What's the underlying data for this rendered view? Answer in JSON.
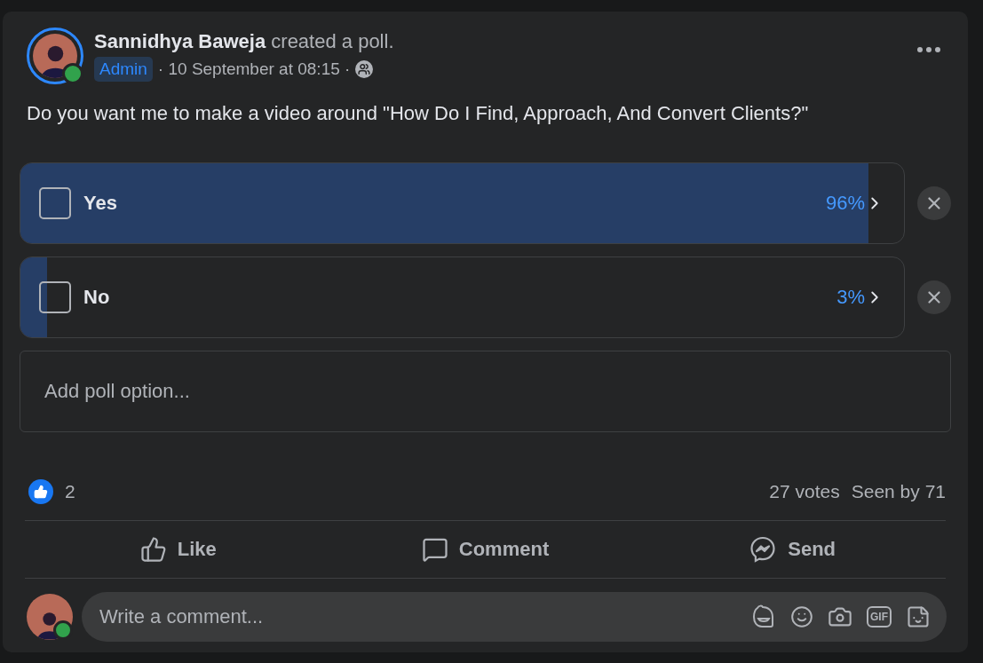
{
  "post": {
    "author": "Sannidhya Baweja",
    "action": "created a poll.",
    "badge": "Admin",
    "timestamp": "· 10 September at 08:15 ·",
    "online": true,
    "question": "Do you want me to make a video around \"How Do I Find, Approach, And Convert Clients?\""
  },
  "poll": {
    "options": [
      {
        "label": "Yes",
        "percent": "96%",
        "level": 0.96,
        "checked": false
      },
      {
        "label": "No",
        "percent": "3%",
        "level": 0.03,
        "checked": false
      }
    ],
    "add_placeholder": "Add poll option..."
  },
  "stats": {
    "reactions": "2",
    "votes": "27 votes",
    "seen": "Seen by 71"
  },
  "actions": [
    {
      "kind": "like",
      "label": "Like"
    },
    {
      "kind": "comment",
      "label": "Comment"
    },
    {
      "kind": "send",
      "label": "Send"
    }
  ],
  "comment": {
    "placeholder": "Write a comment...",
    "online": true,
    "tools": [
      {
        "kind": "avatar"
      },
      {
        "kind": "emoji"
      },
      {
        "kind": "camera"
      },
      {
        "kind": "gif",
        "label": "GIF"
      },
      {
        "kind": "sticker"
      }
    ]
  }
}
